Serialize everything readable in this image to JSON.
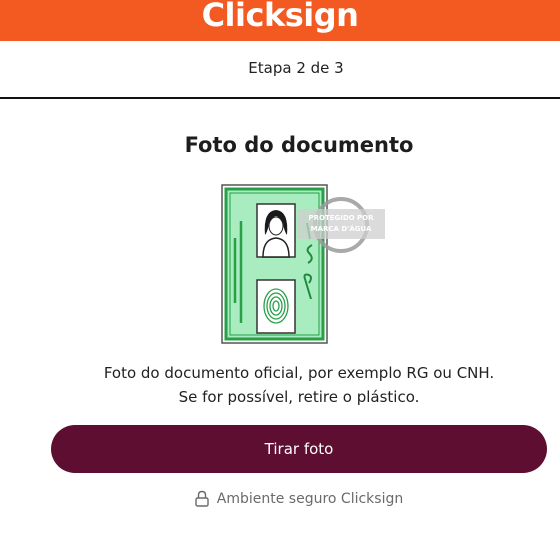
{
  "header": {
    "brand": "Clicksign",
    "brand_color": "#f25a22"
  },
  "progress": {
    "step_text": "Etapa 2 de 3",
    "current_step": 2,
    "total_steps": 3
  },
  "main": {
    "title": "Foto do documento",
    "illustration": {
      "icon": "id-document-icon",
      "watermark": [
        "PROTEGIDO POR",
        "MARCA D'ÁGUA"
      ]
    },
    "description_line1": "Foto do documento oficial, por exemplo RG ou CNH.",
    "description_line2": "Se for possível, retire o plástico.",
    "primary_button": {
      "label": "Tirar foto",
      "color": "#5e0e30"
    },
    "secure_note": {
      "icon": "lock-icon",
      "text": "Ambiente seguro Clicksign"
    }
  }
}
